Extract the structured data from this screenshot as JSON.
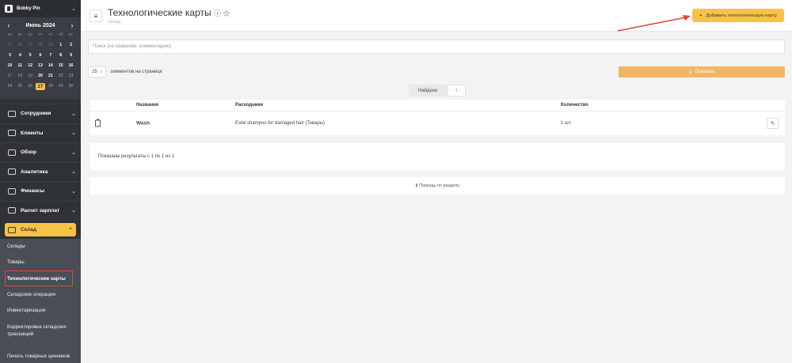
{
  "sidebar": {
    "company": "Bobby Pin",
    "calendar": {
      "title": "Июнь 2024",
      "weekdays": [
        "пн",
        "вт",
        "ср",
        "чт",
        "пт",
        "сб",
        "вс"
      ],
      "days": [
        {
          "d": "27",
          "k": "muted"
        },
        {
          "d": "28",
          "k": "muted"
        },
        {
          "d": "29",
          "k": "muted"
        },
        {
          "d": "30",
          "k": "muted"
        },
        {
          "d": "31",
          "k": "muted"
        },
        {
          "d": "1",
          "k": "cur"
        },
        {
          "d": "2",
          "k": "cur"
        },
        {
          "d": "3",
          "k": "cur"
        },
        {
          "d": "4",
          "k": "cur"
        },
        {
          "d": "5",
          "k": "cur"
        },
        {
          "d": "6",
          "k": "cur"
        },
        {
          "d": "7",
          "k": "cur"
        },
        {
          "d": "8",
          "k": "cur"
        },
        {
          "d": "9",
          "k": "cur"
        },
        {
          "d": "10",
          "k": "cur"
        },
        {
          "d": "11",
          "k": "cur"
        },
        {
          "d": "12",
          "k": "cur"
        },
        {
          "d": "13",
          "k": "cur"
        },
        {
          "d": "14",
          "k": "cur"
        },
        {
          "d": "15",
          "k": "cur"
        },
        {
          "d": "16",
          "k": "cur"
        },
        {
          "d": "17",
          "k": "past"
        },
        {
          "d": "18",
          "k": "past"
        },
        {
          "d": "19",
          "k": "past"
        },
        {
          "d": "20",
          "k": "cur"
        },
        {
          "d": "21",
          "k": "cur"
        },
        {
          "d": "22",
          "k": "past"
        },
        {
          "d": "23",
          "k": "past"
        },
        {
          "d": "24",
          "k": "past"
        },
        {
          "d": "25",
          "k": "past"
        },
        {
          "d": "26",
          "k": "past"
        },
        {
          "d": "27",
          "k": "today"
        },
        {
          "d": "28",
          "k": "past"
        },
        {
          "d": "29",
          "k": "past"
        },
        {
          "d": "30",
          "k": "past"
        }
      ]
    },
    "menu": [
      {
        "label": "Сотрудники",
        "icon": "users-icon",
        "name": "employees"
      },
      {
        "label": "Клиенты",
        "icon": "clients-icon",
        "name": "clients"
      },
      {
        "label": "Обзор",
        "icon": "overview-icon",
        "name": "overview"
      },
      {
        "label": "Аналитика",
        "icon": "analytics-icon",
        "name": "analytics"
      },
      {
        "label": "Финансы",
        "icon": "finance-icon",
        "name": "finance"
      },
      {
        "label": "Расчет зарплат",
        "icon": "payroll-icon",
        "name": "payroll"
      }
    ],
    "active_section": "Склад",
    "submenu": [
      {
        "label": "Склады",
        "active": false
      },
      {
        "label": "Товары",
        "active": false
      },
      {
        "label": "Технологические карты",
        "active": true
      },
      {
        "label": "Складские операции",
        "active": false
      },
      {
        "label": "Инвентаризация",
        "active": false
      },
      {
        "label": "Корректировка складских транзакций",
        "active": false,
        "tall": true
      },
      {
        "label": "Печать товарных ценников",
        "active": false,
        "tall": true
      }
    ]
  },
  "header": {
    "title": "Технологические карты",
    "breadcrumb": "Склад",
    "add_button": "Добавить технологическую карту"
  },
  "search": {
    "placeholder": "Поиск (по названию, комментарию)"
  },
  "perpage": {
    "value": "25",
    "label": "элементов на странице"
  },
  "show_button": "Показать",
  "found": {
    "label": "Найдено",
    "count": "1"
  },
  "table": {
    "headers": {
      "name": "Название",
      "consumables": "Расходники",
      "quantity": "Количество"
    },
    "rows": [
      {
        "name": "Wash",
        "consumables": "Estel shampoo for damaged hair (Товары)",
        "quantity": "1 шт."
      }
    ]
  },
  "results_text": "Показаны результаты с 1 по 1 из 1",
  "help_text": "Помощь по разделу",
  "colors": {
    "accent": "#f6c344",
    "sidebar": "#2f3237",
    "highlight": "#e2463b"
  }
}
